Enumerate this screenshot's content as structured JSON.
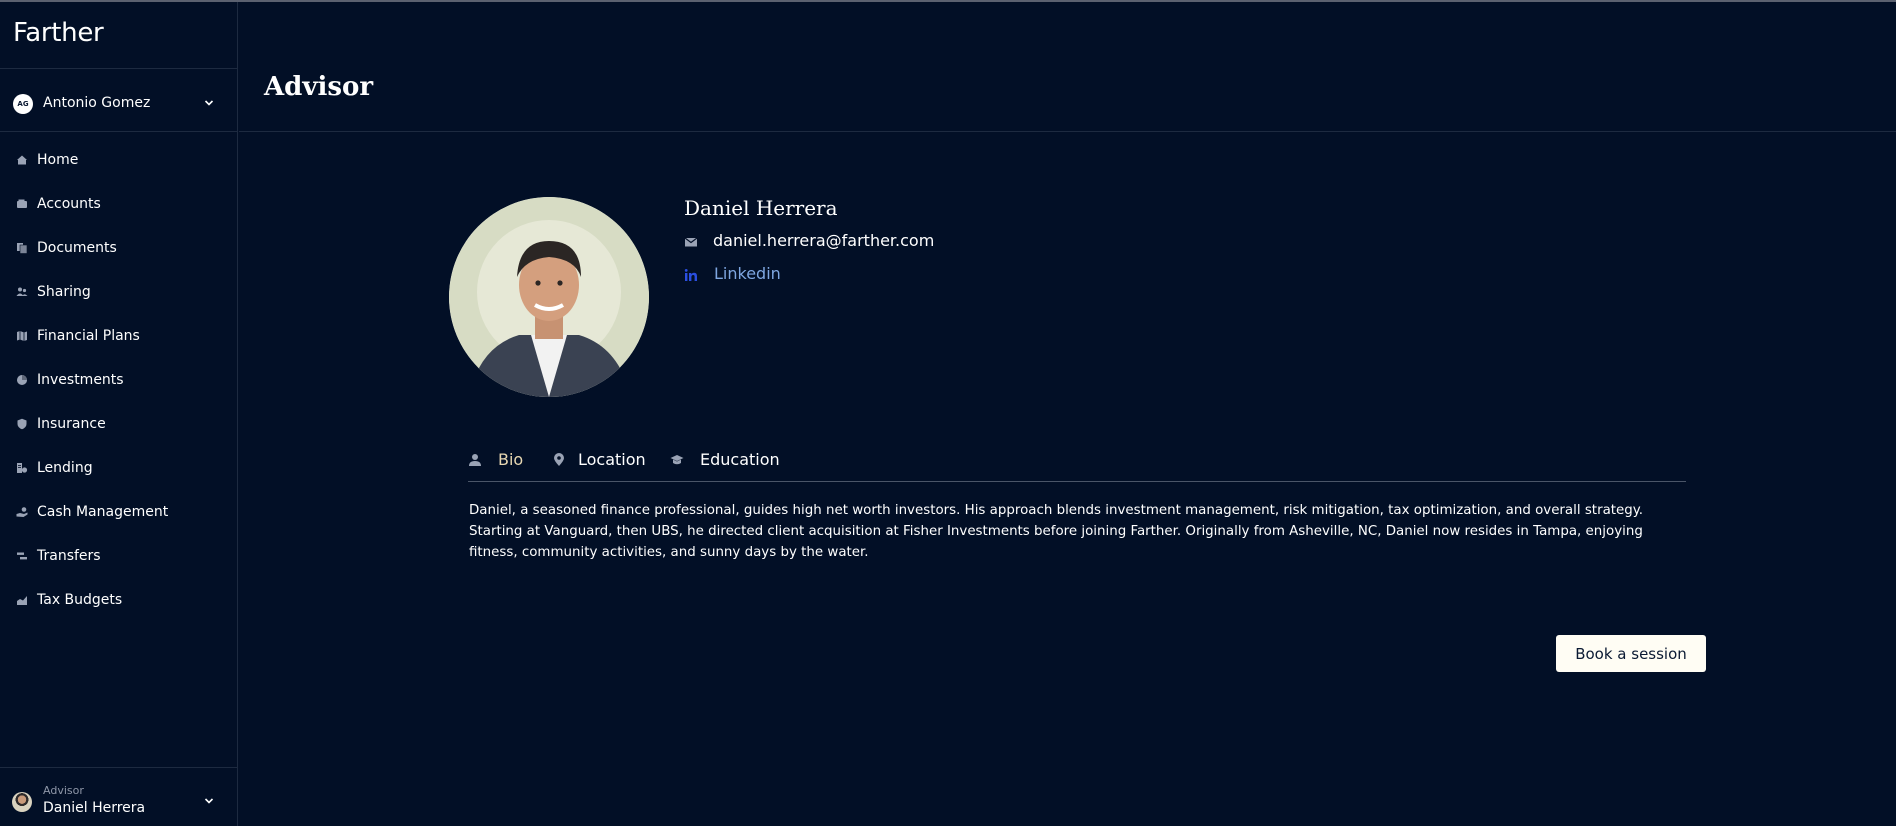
{
  "app": {
    "brand": "Farther"
  },
  "sidebar": {
    "user": {
      "initials": "AG",
      "name": "Antonio Gomez"
    },
    "items": [
      {
        "label": "Home",
        "icon": "home-icon"
      },
      {
        "label": "Accounts",
        "icon": "wallet-icon"
      },
      {
        "label": "Documents",
        "icon": "documents-icon"
      },
      {
        "label": "Sharing",
        "icon": "people-icon"
      },
      {
        "label": "Financial Plans",
        "icon": "map-icon"
      },
      {
        "label": "Investments",
        "icon": "pie-icon"
      },
      {
        "label": "Insurance",
        "icon": "shield-icon"
      },
      {
        "label": "Lending",
        "icon": "lending-icon"
      },
      {
        "label": "Cash Management",
        "icon": "hand-cash-icon"
      },
      {
        "label": "Transfers",
        "icon": "transfer-icon"
      },
      {
        "label": "Tax Budgets",
        "icon": "chart-icon"
      }
    ],
    "advisor": {
      "role": "Advisor",
      "name": "Daniel Herrera"
    }
  },
  "header": {
    "title": "Advisor"
  },
  "advisor": {
    "name": "Daniel Herrera",
    "email": "daniel.herrera@farther.com",
    "linkedin_label": "Linkedin",
    "tabs": [
      {
        "label": "Bio",
        "icon": "person-icon",
        "active": true
      },
      {
        "label": "Location",
        "icon": "location-pin-icon",
        "active": false
      },
      {
        "label": "Education",
        "icon": "graduation-cap-icon",
        "active": false
      }
    ],
    "bio": "Daniel, a seasoned finance professional, guides high net worth investors. His approach blends investment management, risk mitigation, tax optimization, and overall strategy. Starting at Vanguard, then UBS, he directed client acquisition at Fisher Investments before joining Farther. Originally from Asheville, NC, Daniel now resides in Tampa, enjoying fitness, community activities, and sunny days by the water.",
    "book_label": "Book a session"
  },
  "colors": {
    "background": "#020f26",
    "tab_active": "#e7d7b2",
    "link": "#7ea6e0",
    "linkedin_icon": "#2a4ee0",
    "button_bg": "#fffdf4"
  }
}
